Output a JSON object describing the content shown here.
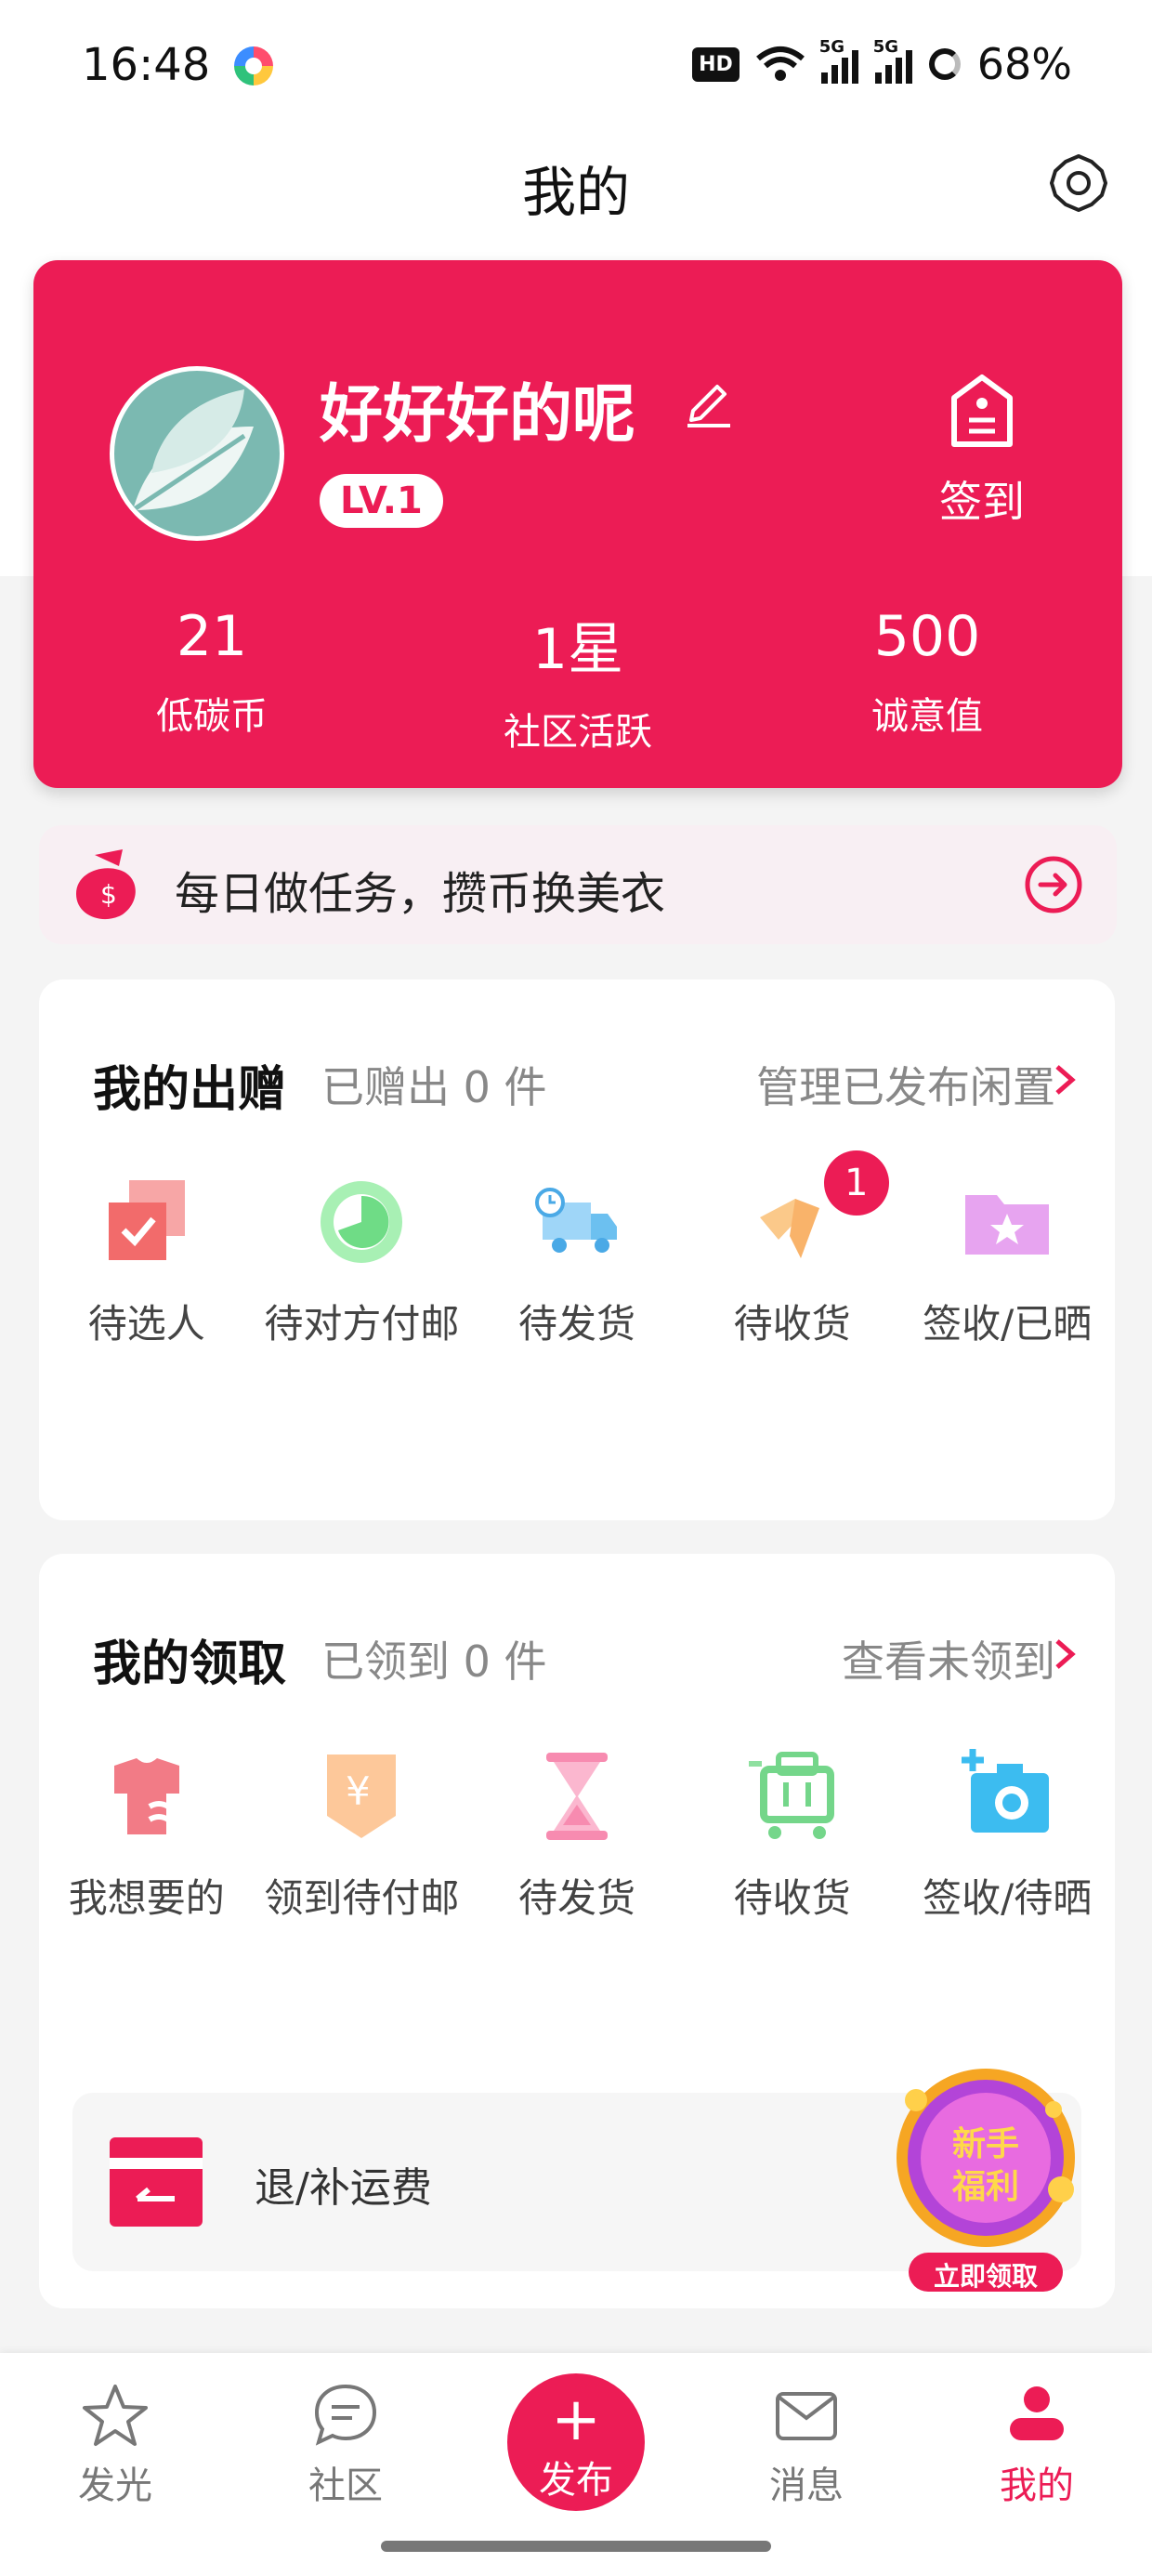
{
  "status_bar": {
    "time": "16:48",
    "hd_label": "HD",
    "net1": "5G",
    "net2": "5G",
    "battery": "68%"
  },
  "header": {
    "title": "我的"
  },
  "profile": {
    "username": "好好好的呢",
    "level": "LV.1",
    "checkin_label": "签到",
    "stats": [
      {
        "value": "21",
        "label": "低碳币"
      },
      {
        "value": "1星",
        "label": "社区活跃"
      },
      {
        "value": "500",
        "label": "诚意值"
      }
    ]
  },
  "task_banner": {
    "text": "每日做任务，攒币换美衣"
  },
  "giving": {
    "title": "我的出赠",
    "summary": "已赠出 0 件",
    "link": "管理已发布闲置",
    "items": [
      {
        "label": "待选人",
        "icon": "candidate-icon"
      },
      {
        "label": "待对方付邮",
        "icon": "waiting-postage-icon"
      },
      {
        "label": "待发货",
        "icon": "delivery-truck-icon"
      },
      {
        "label": "待收货",
        "icon": "receive-icon",
        "badge": "1"
      },
      {
        "label": "签收/已晒",
        "icon": "folder-star-icon"
      }
    ]
  },
  "receiving": {
    "title": "我的领取",
    "summary": "已领到 0 件",
    "link": "查看未领到",
    "items": [
      {
        "label": "我想要的",
        "icon": "clothes-icon"
      },
      {
        "label": "领到待付邮",
        "icon": "yen-pay-icon"
      },
      {
        "label": "待发货",
        "icon": "hourglass-icon"
      },
      {
        "label": "待收货",
        "icon": "cart-icon"
      },
      {
        "label": "签收/待晒",
        "icon": "camera-plus-icon"
      }
    ],
    "refund_label": "退/补运费"
  },
  "promo": {
    "line1": "新手",
    "line2": "福利",
    "cta": "立即领取"
  },
  "tabbar": [
    {
      "label": "发光",
      "icon": "star-icon"
    },
    {
      "label": "社区",
      "icon": "chat-icon"
    },
    {
      "label": "发布",
      "icon": "plus-icon"
    },
    {
      "label": "消息",
      "icon": "mail-icon"
    },
    {
      "label": "我的",
      "icon": "user-icon"
    }
  ],
  "colors": {
    "brand": "#ec1c55",
    "avatar_bg": "#7bb9b1"
  }
}
